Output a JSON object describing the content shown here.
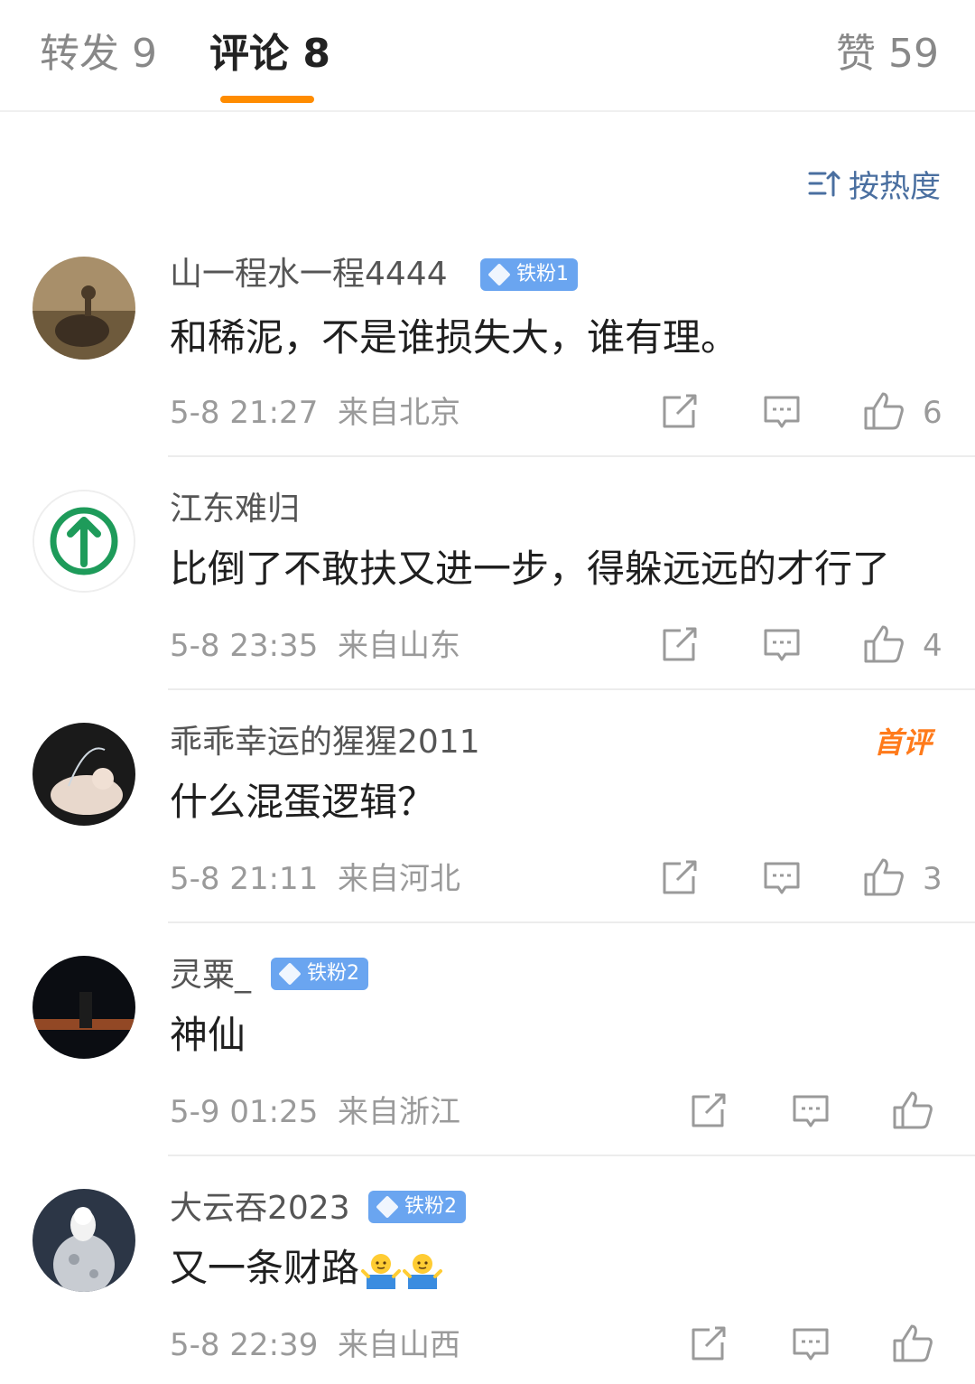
{
  "tabs": {
    "repost": "转发 9",
    "comment": "评论 8",
    "like": "赞 59"
  },
  "sort_label": "按热度",
  "comments": [
    {
      "username": "山一程水一程4444",
      "badge": "铁粉1",
      "text": "和稀泥，不是谁损失大，谁有理。",
      "time": "5-8 21:27",
      "location": "来自北京",
      "likes": "6"
    },
    {
      "username": "江东难归",
      "text": "比倒了不敢扶又进一步，得躲远远的才行了",
      "time": "5-8 23:35",
      "location": "来自山东",
      "likes": "4"
    },
    {
      "username": "乖乖幸运的猩猩2011",
      "tag": "首评",
      "text": "什么混蛋逻辑？",
      "time": "5-8 21:11",
      "location": "来自河北",
      "likes": "3"
    },
    {
      "username": "灵粟_",
      "badge": "铁粉2",
      "text": "神仙",
      "time": "5-9 01:25",
      "location": "来自浙江"
    },
    {
      "username": "大云吞2023",
      "badge": "铁粉2",
      "text": "又一条财路",
      "time": "5-8 22:39",
      "location": "来自山西"
    }
  ],
  "colors": {
    "accent": "#ff8c00",
    "link": "#4a6fa0",
    "badge": "#6aa5f0",
    "first_comment": "#ff7a1a"
  },
  "icons": [
    "sort-icon",
    "repost-icon",
    "reply-icon",
    "like-icon",
    "shrug-emoji-icon"
  ]
}
